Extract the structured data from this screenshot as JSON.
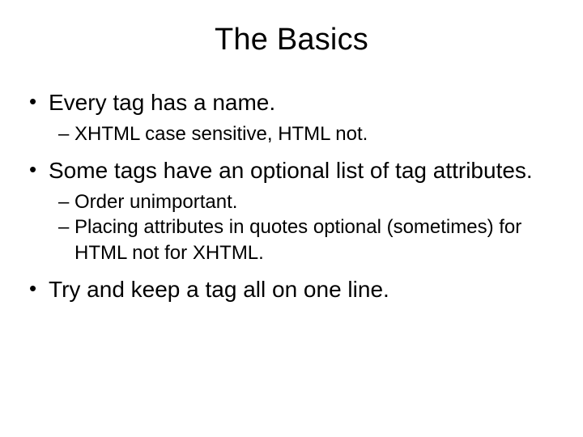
{
  "slide": {
    "title": "The Basics",
    "bullets": [
      {
        "text": "Every tag has a name.",
        "sub": [
          "XHTML case sensitive, HTML not."
        ]
      },
      {
        "text": "Some tags have an optional list of tag attributes.",
        "sub": [
          "Order unimportant.",
          "Placing attributes in quotes optional (sometimes) for HTML not for XHTML."
        ]
      },
      {
        "text": "Try and keep a tag all on one line.",
        "sub": []
      }
    ]
  }
}
